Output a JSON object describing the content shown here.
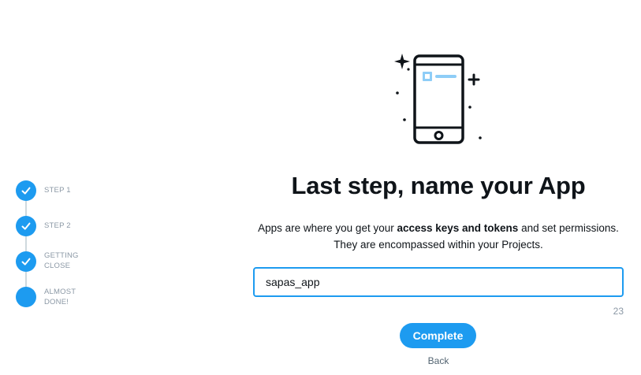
{
  "stepper": {
    "steps": [
      {
        "label": "STEP 1",
        "state": "completed"
      },
      {
        "label": "STEP 2",
        "state": "completed"
      },
      {
        "label": "GETTING CLOSE",
        "state": "completed"
      },
      {
        "label": "ALMOST DONE!",
        "state": "current"
      }
    ]
  },
  "main": {
    "illustration_icon": "smartphone-icon",
    "title": "Last step, name your App",
    "description": {
      "part1": "Apps are where you get your ",
      "bold": "access keys and tokens",
      "part2": " and set permissions. They are encompassed within your Projects."
    },
    "app_name_input": {
      "value": "sapas_app",
      "placeholder": ""
    },
    "char_count": "23",
    "complete_label": "Complete",
    "back_label": "Back"
  },
  "colors": {
    "accent": "#1d9bf0",
    "muted_text": "#8b98a5",
    "text": "#0f1419"
  }
}
